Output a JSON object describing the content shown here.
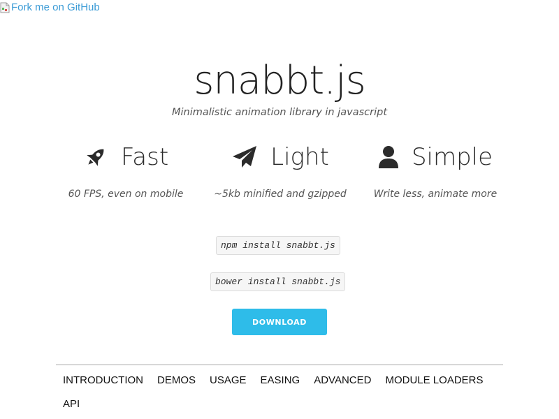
{
  "fork_link": {
    "alt_text": "Fork me on GitHub"
  },
  "header": {
    "title": "snabbt.js",
    "subtitle": "Minimalistic animation library in javascript"
  },
  "features": [
    {
      "icon": "rocket-icon",
      "name": "Fast",
      "description": "60 FPS, even on mobile"
    },
    {
      "icon": "paper-plane-icon",
      "name": "Light",
      "description": "~5kb minified and gzipped"
    },
    {
      "icon": "user-icon",
      "name": "Simple",
      "description": "Write less, animate more"
    }
  ],
  "install": {
    "npm": "npm install snabbt.js",
    "bower": "bower install snabbt.js"
  },
  "download": {
    "label": "DOWNLOAD",
    "color": "#2ebce9"
  },
  "nav": {
    "items": [
      "INTRODUCTION",
      "DEMOS",
      "USAGE",
      "EASING",
      "ADVANCED",
      "MODULE LOADERS",
      "API"
    ]
  }
}
